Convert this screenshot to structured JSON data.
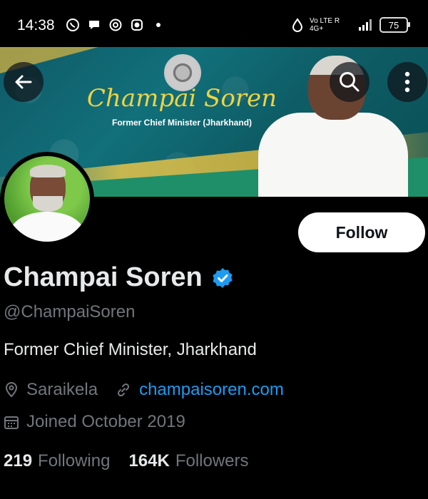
{
  "status_bar": {
    "time": "14:38",
    "network": "Vo LTE R 4G+",
    "battery": "75"
  },
  "banner": {
    "title": "Champai Soren",
    "subtitle": "Former Chief Minister (Jharkhand)"
  },
  "header_icons": {
    "back": "arrow-left-icon",
    "search": "search-icon",
    "more": "more-vertical-icon"
  },
  "profile": {
    "name": "Champai Soren",
    "verified": true,
    "handle": "@ChampaiSoren",
    "bio": "Former Chief Minister, Jharkhand",
    "location": "Saraikela",
    "website": "champaisoren.com",
    "joined": "Joined October 2019",
    "following_count": "219",
    "following_label": "Following",
    "followers_count": "164K",
    "followers_label": "Followers"
  },
  "actions": {
    "follow_label": "Follow"
  },
  "colors": {
    "background": "#000000",
    "accent": "#1d9bf0",
    "secondary_text": "#71767b",
    "banner_gold": "#f0d341"
  }
}
